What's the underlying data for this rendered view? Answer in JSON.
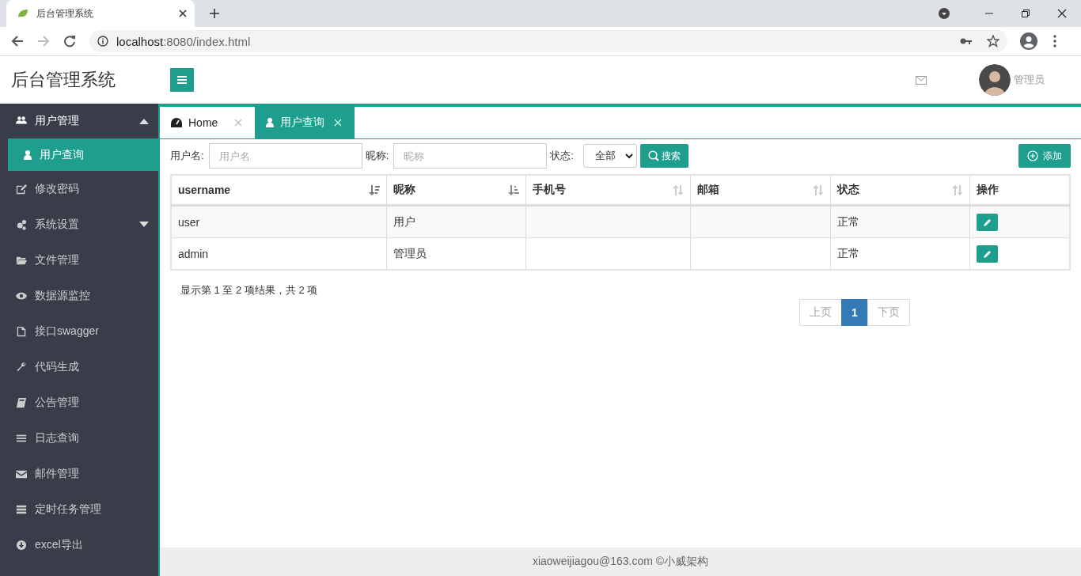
{
  "browser": {
    "tab_title": "后台管理系统",
    "url_host": "localhost",
    "url_rest": ":8080/index.html"
  },
  "header": {
    "title": "后台管理系统",
    "user": "管理员"
  },
  "sidebar": {
    "items": [
      {
        "label": "用户管理",
        "expandable": true,
        "expanded": true,
        "children": [
          {
            "label": "用户查询",
            "selected": true
          }
        ]
      },
      {
        "label": "修改密码",
        "expandable": false,
        "expanded": false
      },
      {
        "label": "系统设置",
        "expandable": true,
        "expanded": false
      },
      {
        "label": "文件管理",
        "expandable": false,
        "expanded": false
      },
      {
        "label": "数据源监控",
        "expandable": false,
        "expanded": false
      },
      {
        "label": "接口swagger",
        "expandable": false,
        "expanded": false
      },
      {
        "label": "代码生成",
        "expandable": false,
        "expanded": false
      },
      {
        "label": "公告管理",
        "expandable": false,
        "expanded": false
      },
      {
        "label": "日志查询",
        "expandable": false,
        "expanded": false
      },
      {
        "label": "邮件管理",
        "expandable": false,
        "expanded": false
      },
      {
        "label": "定时任务管理",
        "expandable": false,
        "expanded": false
      },
      {
        "label": "excel导出",
        "expandable": false,
        "expanded": false
      }
    ]
  },
  "tabs": [
    {
      "label": "Home",
      "selected": false
    },
    {
      "label": "用户查询",
      "selected": true
    }
  ],
  "filters": {
    "username_label": "用户名:",
    "username_placeholder": "用户名",
    "nickname_label": "昵称:",
    "nickname_placeholder": "昵称",
    "status_label": "状态:",
    "status_value": "全部",
    "search_button": "搜索",
    "add_button": "添加"
  },
  "table": {
    "columns": [
      {
        "label": "username",
        "kind": "descending"
      },
      {
        "label": "昵称",
        "kind": "ascending"
      },
      {
        "label": "手机号",
        "kind": "sortable"
      },
      {
        "label": "邮箱",
        "kind": "sortable"
      },
      {
        "label": "状态",
        "kind": "sortable"
      },
      {
        "label": "操作",
        "kind": "plain"
      }
    ],
    "rows": [
      {
        "cells": [
          "user",
          "用户",
          "",
          "",
          "正常"
        ]
      },
      {
        "cells": [
          "admin",
          "管理员",
          "",
          "",
          "正常"
        ]
      }
    ]
  },
  "summary": "显示第 1 至 2 项结果，共 2 项",
  "pagination": {
    "prev": {
      "label": "上页",
      "disabled": true
    },
    "pages": [
      {
        "label": "1",
        "selected": true
      }
    ],
    "next": {
      "label": "下页",
      "disabled": true
    }
  },
  "footer": "xiaoweijiagou@163.com ©小威架构"
}
